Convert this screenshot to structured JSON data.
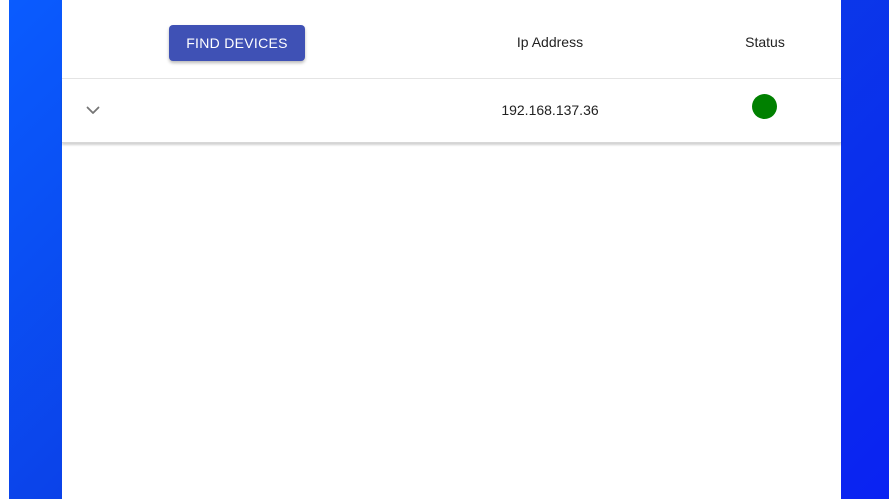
{
  "toolbar": {
    "find_devices_label": "FIND DEVICES"
  },
  "table": {
    "columns": [
      "Ip Address",
      "Status"
    ],
    "rows": [
      {
        "ip_address": "192.168.137.36",
        "status_color": "#008000",
        "expand_icon": "chevron-down-icon"
      }
    ]
  },
  "colors": {
    "accent": "#3f51b5",
    "background_gradient": [
      "#0a5cff",
      "#0a22f2"
    ],
    "status_online": "#008000"
  }
}
